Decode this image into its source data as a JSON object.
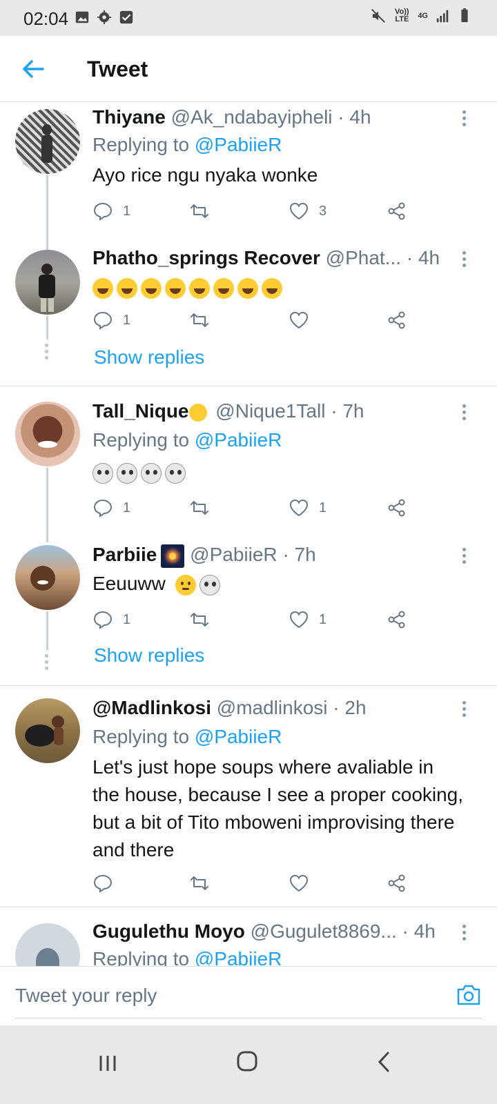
{
  "status_bar": {
    "time": "02:04",
    "network_volte": "Vo)) LTE",
    "network_type": "4G"
  },
  "header": {
    "title": "Tweet"
  },
  "tweets": [
    {
      "name": "Thiyane",
      "handle": "@Ak_ndabayipheli",
      "time": "· 4h",
      "replying_label": "Replying to",
      "replying_to": "@PabiieR",
      "text": "Ayo rice ngu nyaka wonke",
      "reply_count": "1",
      "retweet_count": "",
      "like_count": "3"
    },
    {
      "name": "Phatho_springs Recover",
      "handle": "@Phat...",
      "time": "· 4h",
      "emoji": "🤣🤣🤣🤣🤣🤣🤣🤣",
      "reply_count": "1",
      "retweet_count": "",
      "like_count": "",
      "show_replies": "Show replies"
    },
    {
      "name": "Tall_Nique",
      "handle": "@Nique1Tall",
      "time": "· 7h",
      "replying_label": "Replying to",
      "replying_to": "@PabiieR",
      "emoji": "💀💀💀💀",
      "reply_count": "1",
      "retweet_count": "",
      "like_count": "1"
    },
    {
      "name": "Parbiie",
      "handle": "@PabiieR",
      "time": "· 7h",
      "text": "Eeuuww",
      "reply_count": "1",
      "retweet_count": "",
      "like_count": "1",
      "show_replies": "Show replies"
    },
    {
      "name": "@Madlinkosi",
      "handle": "@madlinkosi",
      "time": "· 2h",
      "replying_label": "Replying to",
      "replying_to": "@PabiieR",
      "text": "Let's just hope soups where avaliable in the house, because I see a proper cooking, but a bit of Tito mboweni improvising there and there",
      "reply_count": "",
      "retweet_count": "",
      "like_count": ""
    },
    {
      "name": "Gugulethu Moyo",
      "handle": "@Gugulet8869...",
      "time": "· 4h",
      "replying_label": "Replying to",
      "replying_to": "@PabiieR"
    }
  ],
  "reply_bar": {
    "placeholder": "Tweet your reply"
  },
  "colors": {
    "accent": "#1da1f2",
    "secondary_text": "#657786",
    "primary_text": "#14171a"
  }
}
